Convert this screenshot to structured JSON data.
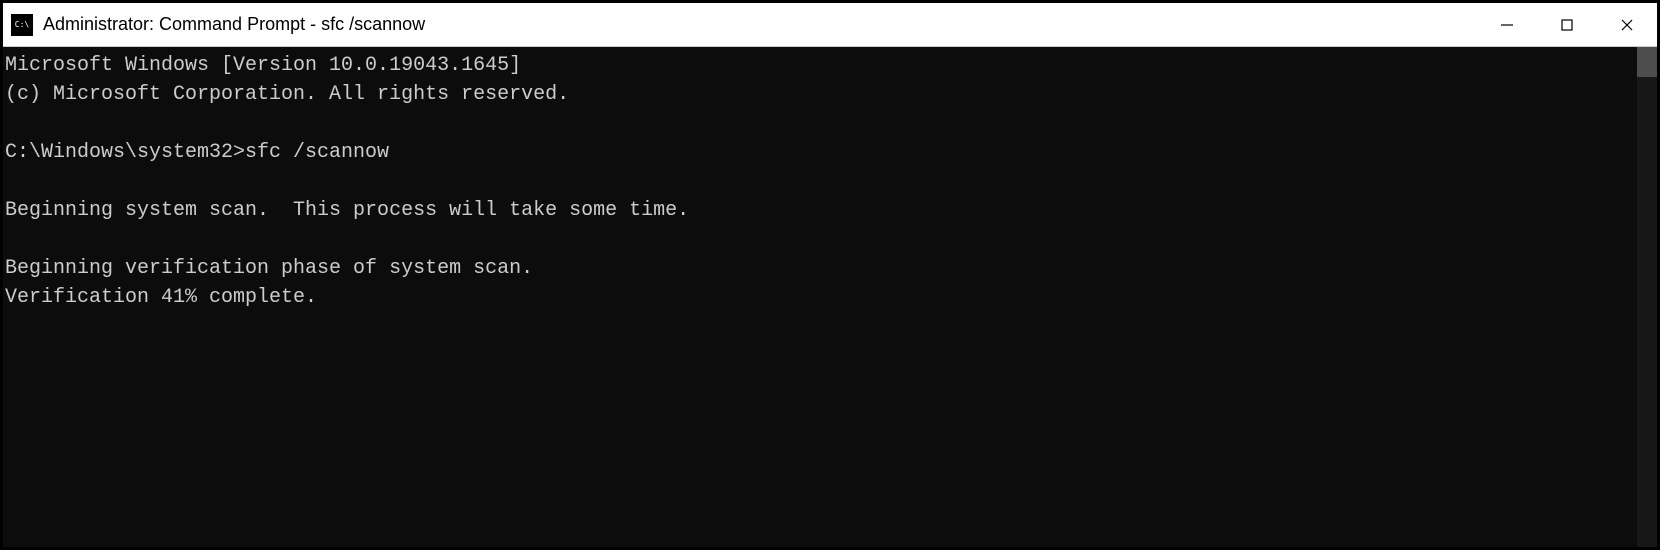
{
  "titlebar": {
    "title": "Administrator: Command Prompt - sfc  /scannow"
  },
  "terminal": {
    "lines": [
      "Microsoft Windows [Version 10.0.19043.1645]",
      "(c) Microsoft Corporation. All rights reserved.",
      "",
      "C:\\Windows\\system32>sfc /scannow",
      "",
      "Beginning system scan.  This process will take some time.",
      "",
      "Beginning verification phase of system scan.",
      "Verification 41% complete."
    ]
  }
}
